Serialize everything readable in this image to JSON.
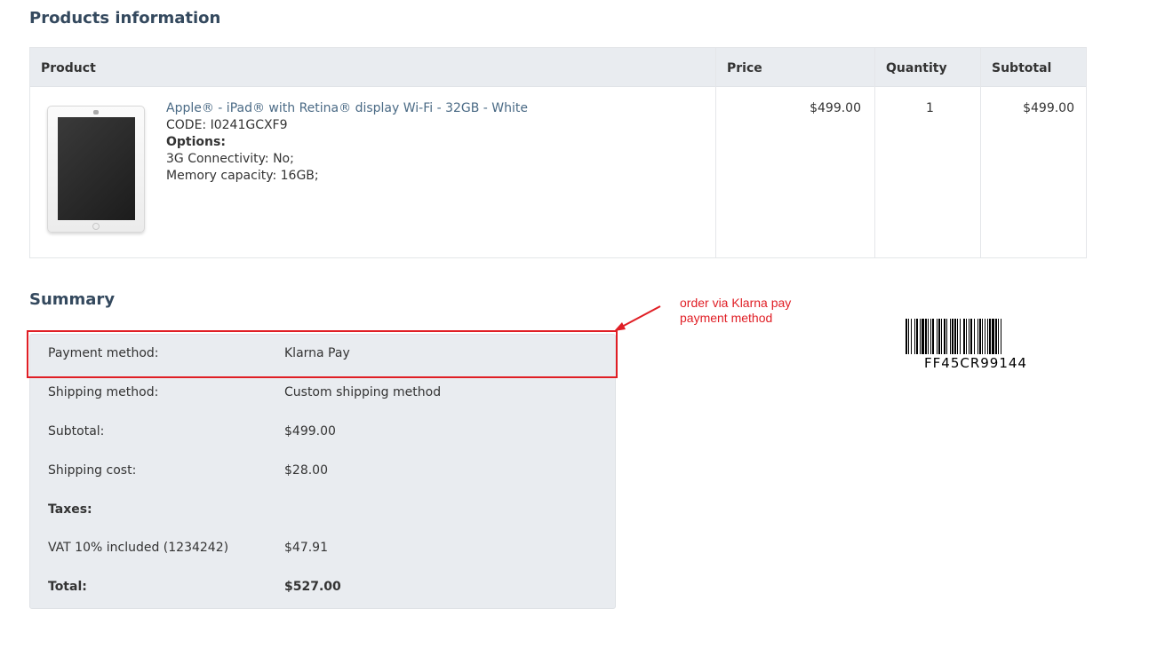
{
  "products": {
    "title": "Products information",
    "columns": [
      "Product",
      "Price",
      "Quantity",
      "Subtotal"
    ],
    "items": [
      {
        "name": "Apple® - iPad® with Retina® display Wi-Fi - 32GB - White",
        "code": "CODE: I0241GCXF9",
        "options_title": "Options:",
        "options": [
          "3G Connectivity: No;",
          "Memory capacity: 16GB;"
        ],
        "price": "$499.00",
        "quantity": "1",
        "subtotal": "$499.00"
      }
    ]
  },
  "summary": {
    "title": "Summary",
    "rows": [
      {
        "label": "Payment method:",
        "value": "Klarna Pay"
      },
      {
        "label": "Shipping method:",
        "value": "Custom shipping method"
      },
      {
        "label": "Subtotal:",
        "value": "$499.00"
      },
      {
        "label": "Shipping cost:",
        "value": "$28.00"
      },
      {
        "label": "Taxes:",
        "value": ""
      },
      {
        "label": "VAT 10% included (1234242)",
        "value": "$47.91"
      },
      {
        "label": "Total:",
        "value": "$527.00"
      }
    ]
  },
  "annotation": {
    "text_line1": "order via Klarna pay",
    "text_line2": "payment method",
    "color": "#e01e25"
  },
  "barcode": {
    "code": "FF45CR99144"
  },
  "colors": {
    "heading": "#34495e",
    "table_header_bg": "#e9ecf0",
    "link": "#4a6a85"
  }
}
